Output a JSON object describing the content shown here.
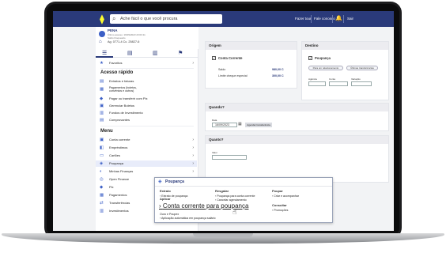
{
  "topbar": {
    "search_placeholder": "Ache fácil o que você procura",
    "links": [
      "Fazer tour",
      "Fale conosco",
      "Sair"
    ]
  },
  "account": {
    "name": "PENA",
    "line1": "Último acesso: 16/09/2023 23:03:11",
    "line2": "Saldo bloqueado",
    "agency": "Ag. 0771-4  Cc. 25827-6"
  },
  "sidebar": {
    "quick_title": "Acesso rápido",
    "quick": [
      {
        "icon": "★",
        "label": "Favoritos",
        "chevron": true
      },
      {
        "icon": "▤",
        "label": "Extratos e faturas"
      },
      {
        "icon": "▦",
        "label": "Pagamentos (boletos, convênios e outros)",
        "label2": true
      },
      {
        "icon": "◆",
        "label": "Pagar ou transferir com Pix"
      },
      {
        "icon": "▣",
        "label": "Gerenciar Boletos"
      },
      {
        "icon": "▥",
        "label": "Fundos de Investimento"
      },
      {
        "icon": "▤",
        "label": "Comprovantes"
      }
    ],
    "menu_title": "Menu",
    "menu": [
      {
        "icon": "▣",
        "label": "Conta corrente"
      },
      {
        "icon": "◧",
        "label": "Empréstimos"
      },
      {
        "icon": "▭",
        "label": "Cartões"
      },
      {
        "icon": "◈",
        "label": "Poupança",
        "active": true
      },
      {
        "icon": "◐",
        "label": "Minhas Finanças"
      },
      {
        "icon": "◎",
        "label": "Open Finance"
      },
      {
        "icon": "◆",
        "label": "Pix"
      },
      {
        "icon": "▦",
        "label": "Pagamentos"
      },
      {
        "icon": "⇄",
        "label": "Transferências"
      },
      {
        "icon": "▥",
        "label": "Investimentos"
      }
    ]
  },
  "main": {
    "origem": {
      "title": "Origem",
      "checkbox_label": "Conta Corrente",
      "saldo_label": "Saldo",
      "saldo_value": "980,00 C",
      "limite_label": "Limite cheque especial",
      "limite_value": "300,00 C"
    },
    "destino": {
      "title": "Destino",
      "checkbox_label": "Poupança",
      "pill1": "Para um relacionamento",
      "pill2": "Últimas transferências",
      "agencia": "Agência",
      "conta": "Conta",
      "variacao": "Variação"
    },
    "quando": {
      "title": "Quando?",
      "data_label": "Data",
      "date": "16/09/2023",
      "agendar_button": "Agendar transferência"
    },
    "quanto": {
      "title": "Quanto?",
      "valor_label": "Valor"
    }
  },
  "popover": {
    "title": "Poupança",
    "columns": [
      {
        "head": "Extrato",
        "links": [
          "Extrato de poupança"
        ]
      },
      {
        "head": "Resgatar",
        "links": [
          "Poupança para conta corrente",
          "Cancelar agendamento"
        ]
      },
      {
        "head": "Poupar",
        "links": [
          "Criar e acompanhar"
        ]
      }
    ],
    "aplicar_head": "Aplicar",
    "aplicar_big": "Conta corrente para poupança",
    "aplicar_links": [
      "Ouro e Poupex",
      "Aplicação automática em poupança salário"
    ],
    "consultar_head": "Consultar",
    "consultar_links": [
      "Promoções"
    ]
  }
}
